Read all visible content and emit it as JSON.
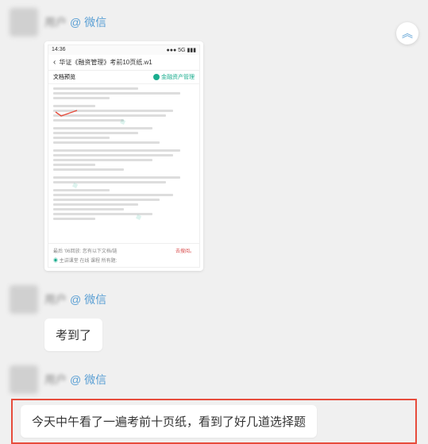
{
  "scrollBtn": "︽",
  "senders": {
    "tag": "@ 微信",
    "blur1": "用户",
    "blur2": "用户",
    "blur3": "用户"
  },
  "phone": {
    "time": "14:36",
    "signal": "●●● 5G ▮▮▮",
    "back": "‹",
    "title": "华证《融资管理》考前10页纸.w1",
    "subLeft": "文档预览",
    "brand": "金融资产管理",
    "footerMain": "最后 '06回放: 您有以下文档/链",
    "footerSub": "主讲课堂  在线 课程  所有题:",
    "footerRight": "去搜阅。"
  },
  "messages": {
    "m2": "考到了",
    "m3": "今天中午看了一遍考前十页纸，看到了好几道选择题"
  }
}
